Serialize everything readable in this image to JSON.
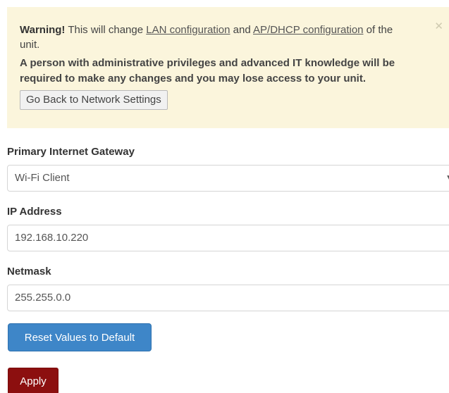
{
  "warning": {
    "strong": "Warning!",
    "text1": "This will change",
    "link1": "LAN configuration",
    "and": "and",
    "link2": "AP/DHCP configuration",
    "text2": "of the unit.",
    "bold_text": "A person with administrative privileges and advanced IT knowledge will be required to make any changes and you may lose access to your unit.",
    "back_button": "Go Back to Network Settings"
  },
  "gateway": {
    "label": "Primary Internet Gateway",
    "value": "Wi-Fi Client"
  },
  "ip": {
    "label": "IP Address",
    "value": "192.168.10.220"
  },
  "netmask": {
    "label": "Netmask",
    "value": "255.255.0.0"
  },
  "buttons": {
    "reset": "Reset Values to Default",
    "apply": "Apply"
  },
  "colors": {
    "warning_bg": "#fbf5dc",
    "reset_button": "#3e86c8",
    "apply_button": "#8c0f0f"
  }
}
